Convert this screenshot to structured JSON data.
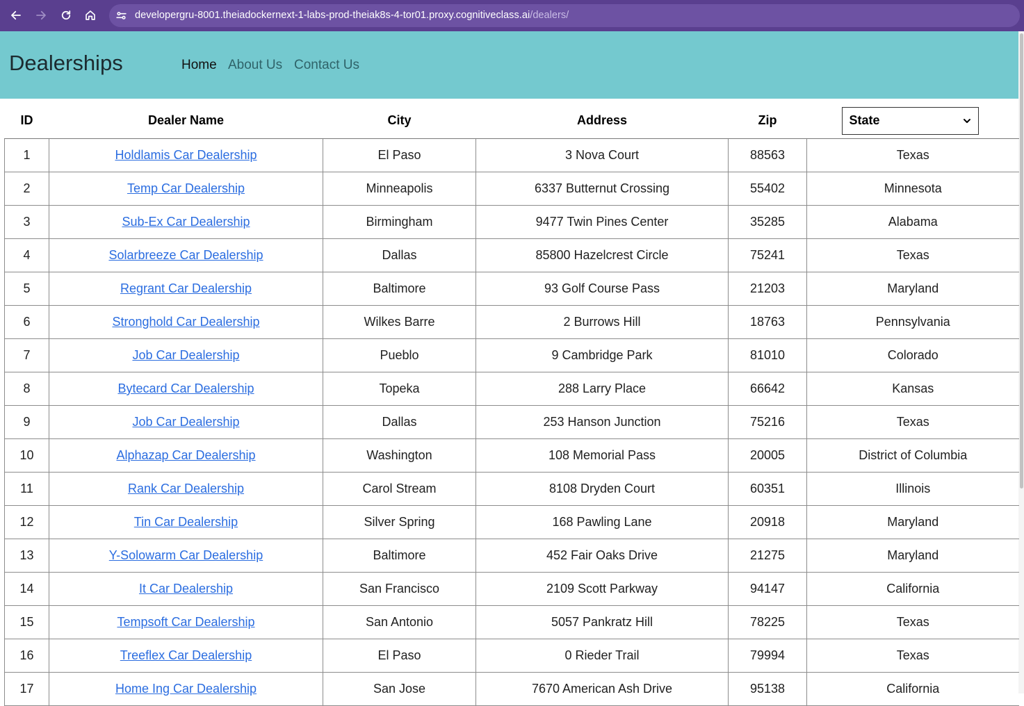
{
  "browser": {
    "url_host": "developergru-8001.theiadockernext-1-labs-prod-theiak8s-4-tor01.proxy.cognitiveclass.ai",
    "url_path": "/dealers/",
    "icons": [
      "back-icon",
      "forward-icon",
      "reload-icon",
      "home-icon",
      "site-info-icon"
    ]
  },
  "header": {
    "brand": "Dealerships",
    "nav": [
      "Home",
      "About Us",
      "Contact Us"
    ],
    "active": "Home",
    "background": "#74c9cf"
  },
  "table": {
    "columns": [
      "ID",
      "Dealer Name",
      "City",
      "Address",
      "Zip"
    ],
    "state_filter": "State",
    "rows": [
      {
        "id": "1",
        "name": "Holdlamis Car Dealership",
        "city": "El Paso",
        "address": "3 Nova Court",
        "zip": "88563",
        "state": "Texas"
      },
      {
        "id": "2",
        "name": "Temp Car Dealership",
        "city": "Minneapolis",
        "address": "6337 Butternut Crossing",
        "zip": "55402",
        "state": "Minnesota"
      },
      {
        "id": "3",
        "name": "Sub-Ex Car Dealership",
        "city": "Birmingham",
        "address": "9477 Twin Pines Center",
        "zip": "35285",
        "state": "Alabama"
      },
      {
        "id": "4",
        "name": "Solarbreeze Car Dealership",
        "city": "Dallas",
        "address": "85800 Hazelcrest Circle",
        "zip": "75241",
        "state": "Texas"
      },
      {
        "id": "5",
        "name": "Regrant Car Dealership",
        "city": "Baltimore",
        "address": "93 Golf Course Pass",
        "zip": "21203",
        "state": "Maryland"
      },
      {
        "id": "6",
        "name": "Stronghold Car Dealership",
        "city": "Wilkes Barre",
        "address": "2 Burrows Hill",
        "zip": "18763",
        "state": "Pennsylvania"
      },
      {
        "id": "7",
        "name": "Job Car Dealership",
        "city": "Pueblo",
        "address": "9 Cambridge Park",
        "zip": "81010",
        "state": "Colorado"
      },
      {
        "id": "8",
        "name": "Bytecard Car Dealership",
        "city": "Topeka",
        "address": "288 Larry Place",
        "zip": "66642",
        "state": "Kansas"
      },
      {
        "id": "9",
        "name": "Job Car Dealership",
        "city": "Dallas",
        "address": "253 Hanson Junction",
        "zip": "75216",
        "state": "Texas"
      },
      {
        "id": "10",
        "name": "Alphazap Car Dealership",
        "city": "Washington",
        "address": "108 Memorial Pass",
        "zip": "20005",
        "state": "District of Columbia"
      },
      {
        "id": "11",
        "name": "Rank Car Dealership",
        "city": "Carol Stream",
        "address": "8108 Dryden Court",
        "zip": "60351",
        "state": "Illinois"
      },
      {
        "id": "12",
        "name": "Tin Car Dealership",
        "city": "Silver Spring",
        "address": "168 Pawling Lane",
        "zip": "20918",
        "state": "Maryland"
      },
      {
        "id": "13",
        "name": "Y-Solowarm Car Dealership",
        "city": "Baltimore",
        "address": "452 Fair Oaks Drive",
        "zip": "21275",
        "state": "Maryland"
      },
      {
        "id": "14",
        "name": "It Car Dealership",
        "city": "San Francisco",
        "address": "2109 Scott Parkway",
        "zip": "94147",
        "state": "California"
      },
      {
        "id": "15",
        "name": "Tempsoft Car Dealership",
        "city": "San Antonio",
        "address": "5057 Pankratz Hill",
        "zip": "78225",
        "state": "Texas"
      },
      {
        "id": "16",
        "name": "Treeflex Car Dealership",
        "city": "El Paso",
        "address": "0 Rieder Trail",
        "zip": "79994",
        "state": "Texas"
      },
      {
        "id": "17",
        "name": "Home Ing Car Dealership",
        "city": "San Jose",
        "address": "7670 American Ash Drive",
        "zip": "95138",
        "state": "California"
      }
    ]
  }
}
